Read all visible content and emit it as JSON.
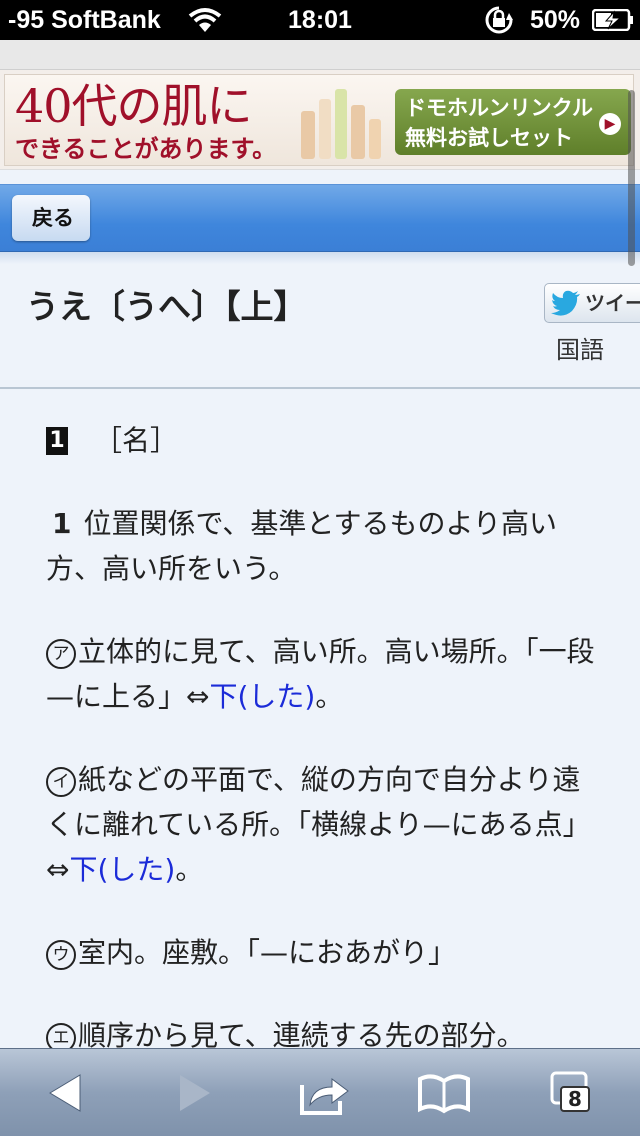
{
  "status_bar": {
    "carrier": "-95 SoftBank",
    "time": "18:01",
    "battery_percent": "50%",
    "icons": [
      "wifi-icon",
      "orientation-lock-icon",
      "battery-charging-icon"
    ]
  },
  "ad": {
    "title": "40代の肌に",
    "subtitle": "できることがあります。",
    "button_line1": "ドモホルンリンクル",
    "button_line2": "無料お試しセット",
    "arrow": "▶"
  },
  "nav": {
    "back_label": "戻る"
  },
  "entry": {
    "title": "うえ〔うへ〕【上】",
    "tweet_label": "ツイート",
    "category": "国語"
  },
  "content": {
    "pos_number": "1",
    "pos_label": "［名］",
    "def1_num": "1",
    "def1_text": "位置関係で、基準とするものより高い方、高い所をいう。",
    "items": [
      {
        "mark": "ア",
        "text": "立体的に見て、高い所。高い場所。「一段—に上る」⇔",
        "link": "下(した)",
        "tail": "。"
      },
      {
        "mark": "イ",
        "text": "紙などの平面で、縦の方向で自分より遠くに離れている所。「横線より—にある点」⇔",
        "link": "下(した)",
        "tail": "。"
      },
      {
        "mark": "ウ",
        "text": "室内。座敷。「—におあがり」",
        "link": "",
        "tail": ""
      },
      {
        "mark": "エ",
        "text": "順序から見て、連続する先の部分。",
        "link": "",
        "tail": ""
      }
    ]
  },
  "toolbar": {
    "tab_count": "8",
    "icons": [
      "back-arrow-icon",
      "forward-arrow-icon",
      "share-icon",
      "bookmarks-icon",
      "tabs-icon"
    ]
  }
}
